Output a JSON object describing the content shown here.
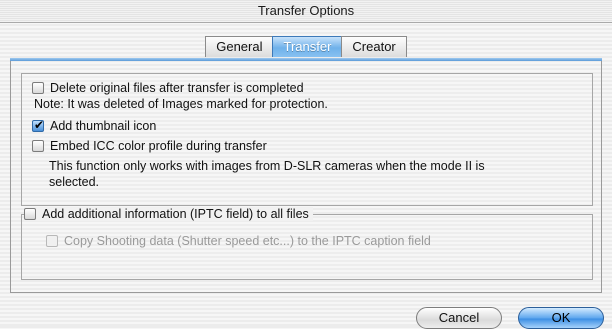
{
  "window": {
    "title": "Transfer Options"
  },
  "tabs": [
    {
      "label": "General",
      "active": false
    },
    {
      "label": "Transfer",
      "active": true
    },
    {
      "label": "Creator",
      "active": false
    }
  ],
  "options": {
    "delete_original": {
      "label": "Delete original files after transfer is completed",
      "checked": false
    },
    "delete_note": "Note: It was deleted of Images marked for protection.",
    "add_thumbnail": {
      "label": "Add thumbnail icon",
      "checked": true
    },
    "embed_icc": {
      "label": "Embed ICC color profile during transfer",
      "checked": false
    },
    "embed_note_line1": "This function only works with images from D-SLR cameras when the mode II is",
    "embed_note_line2": "selected."
  },
  "iptc": {
    "add_info": {
      "label": "Add additional information (IPTC field) to all files",
      "checked": false
    },
    "copy_shooting": {
      "label": "Copy Shooting data (Shutter speed etc...)  to the IPTC caption field",
      "checked": false,
      "disabled": true
    }
  },
  "buttons": {
    "cancel": "Cancel",
    "ok": "OK"
  },
  "colors": {
    "accent": "#5fa7ee",
    "tab_active": "#6fb1ea"
  }
}
